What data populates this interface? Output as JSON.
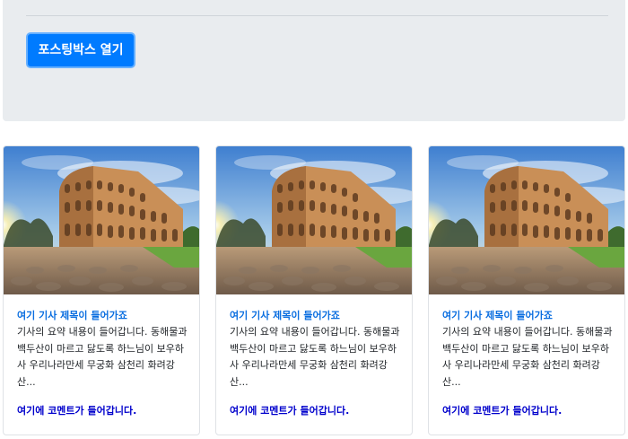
{
  "header": {
    "open_button_label": "포스팅박스 열기"
  },
  "cards": [
    {
      "image": "colosseum-photo",
      "title": "여기 기사 제목이 들어가죠",
      "summary": "기사의 요약 내용이 들어갑니다. 동해물과 백두산이 마르고 닳도록 하느님이 보우하사 우리나라만세 무궁화 삼천리 화려강산...",
      "comment": "여기에 코멘트가 들어갑니다."
    },
    {
      "image": "colosseum-photo",
      "title": "여기 기사 제목이 들어가죠",
      "summary": "기사의 요약 내용이 들어갑니다. 동해물과 백두산이 마르고 닳도록 하느님이 보우하사 우리나라만세 무궁화 삼천리 화려강산...",
      "comment": "여기에 코멘트가 들어갑니다."
    },
    {
      "image": "colosseum-photo",
      "title": "여기 기사 제목이 들어가죠",
      "summary": "기사의 요약 내용이 들어갑니다. 동해물과 백두산이 마르고 닳도록 하느님이 보우하사 우리나라만세 무궁화 삼천리 화려강산...",
      "comment": "여기에 코멘트가 들어갑니다."
    }
  ]
}
